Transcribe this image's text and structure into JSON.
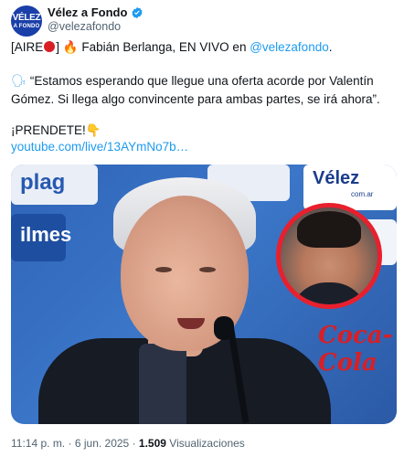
{
  "author": {
    "avatar_line1": "VÉLEZ",
    "avatar_line2": "A FONDO",
    "display_name": "Vélez a Fondo",
    "handle": "@velezafondo"
  },
  "tweet": {
    "line1_prefix": "[AIRE",
    "line1_mid": "] ",
    "line1_main": " Fabián Berlanga, EN VIVO en ",
    "line1_mention": "@velezafondo",
    "line1_suffix": ".",
    "quote": "“Estamos esperando que llegue una oferta acorde por Valentín Gómez. Si llega algo convincente para ambas partes, se irá ahora”.",
    "cta": "¡PRENDETE!",
    "link": "youtube.com/live/13AYmNo7b…"
  },
  "media": {
    "wall_text_1": "plag",
    "wall_text_2": "ilmes",
    "wall_text_3": "Vélez",
    "wall_text_4": "com.ar",
    "wall_text_5": "Coca-Cola"
  },
  "meta": {
    "time": "11:14 p. m.",
    "separator": "·",
    "date": "6 jun. 2025",
    "views_count": "1.509",
    "views_label": "Visualizaciones"
  },
  "colors": {
    "link": "#1d9bf0",
    "verified": "#1d9bf0",
    "live_dot": "#d81f26",
    "inset_ring": "#e8202e"
  },
  "icons": [
    "verified-badge-icon",
    "red-circle-icon",
    "fire-icon",
    "speaking-head-icon",
    "pointing-hand-icon"
  ]
}
